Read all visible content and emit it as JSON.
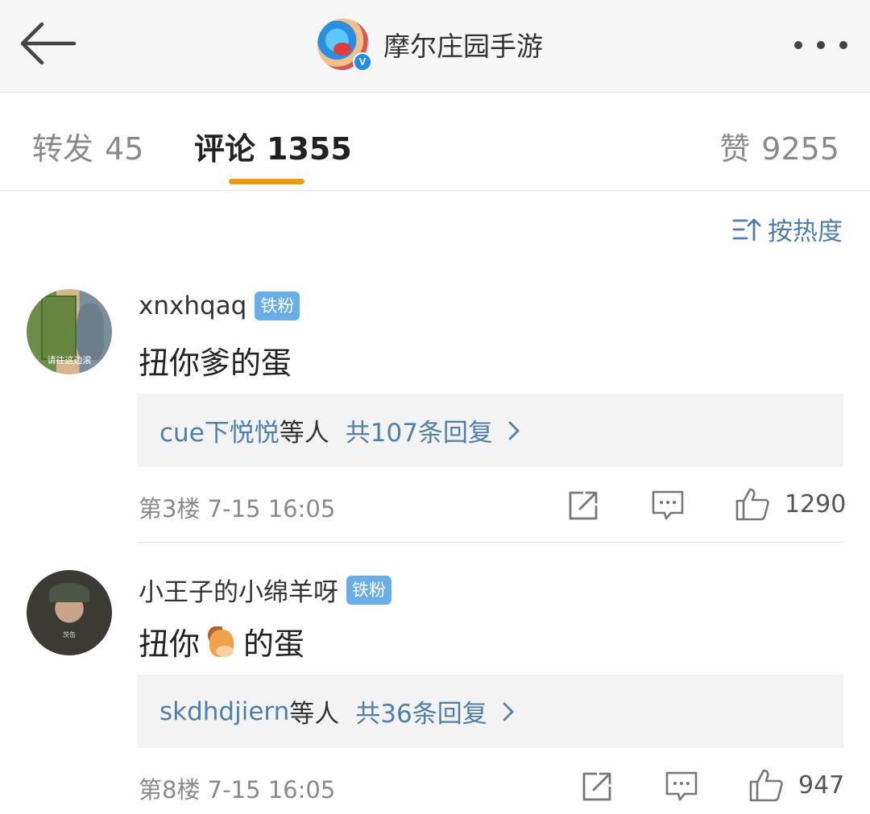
{
  "header": {
    "title": "摩尔庄园手游",
    "verified_mark": "V",
    "back_icon": "back-arrow-icon",
    "more_icon": "more-dots-icon"
  },
  "tabs": [
    {
      "label": "转发",
      "count": "45"
    },
    {
      "label": "评论",
      "count": "1355"
    },
    {
      "label": "赞",
      "count": "9255"
    }
  ],
  "active_tab_color": "#f29a12",
  "sort": {
    "label": "按热度",
    "icon": "sort-icon"
  },
  "comments": [
    {
      "username": "xnxhqaq",
      "badge": "铁粉",
      "avatar_caption": "请往这边滚",
      "text": "扭你爹的蛋",
      "reply_names": "cue下悦悦",
      "reply_mid": "等人",
      "reply_count": "共107条回复",
      "floor_time": "第3楼 7-15 16:05",
      "likes": "1290"
    },
    {
      "username": "小王子的小绵羊呀",
      "badge": "铁粉",
      "avatar_caption": "茨缶",
      "text_before": "扭你",
      "emoji": "horse-emoji",
      "text_after": "的蛋",
      "reply_names": "skdhdjiern",
      "reply_mid": "等人",
      "reply_count": "共36条回复",
      "floor_time": "第8楼 7-15 16:05",
      "likes": "947"
    }
  ],
  "colors": {
    "link": "#4f7fab",
    "badge": "#6aaee8",
    "verified": "#1f8de8"
  }
}
